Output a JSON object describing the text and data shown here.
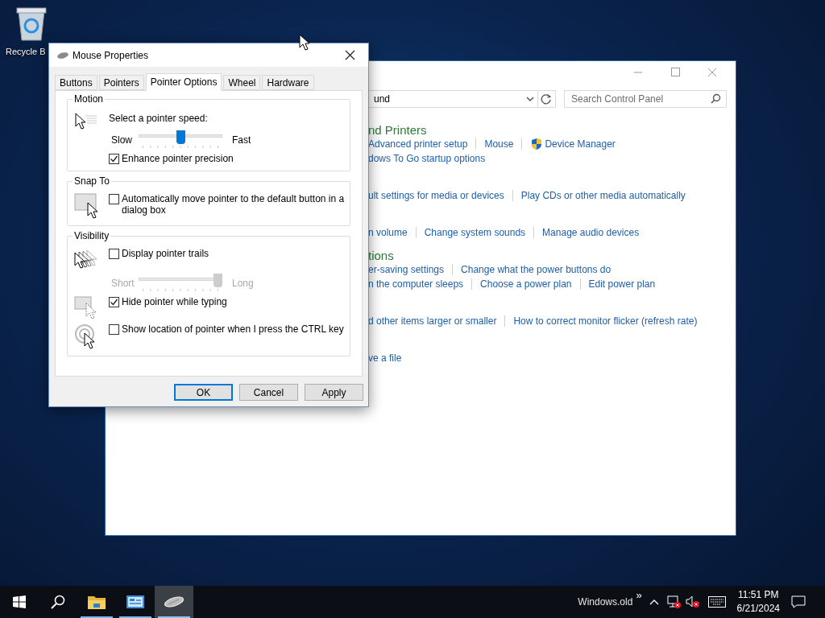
{
  "desktop": {
    "icons": [
      {
        "label": "Recycle B"
      }
    ]
  },
  "control_panel": {
    "address": "und",
    "search_placeholder": "Search Control Panel",
    "sections": [
      {
        "heading": "nd Printers",
        "rows": [
          [
            {
              "text": "Advanced printer setup"
            },
            {
              "text": "Mouse"
            },
            {
              "text": "Device Manager",
              "shield": true
            }
          ],
          [
            {
              "text": "dows To Go startup options"
            }
          ]
        ]
      },
      {
        "rows": [
          [
            {
              "text": "ult settings for media or devices"
            },
            {
              "text": "Play CDs or other media automatically"
            }
          ]
        ]
      },
      {
        "rows": [
          [
            {
              "text": "n volume"
            },
            {
              "text": "Change system sounds"
            },
            {
              "text": "Manage audio devices"
            }
          ]
        ]
      },
      {
        "heading": "tions",
        "rows": [
          [
            {
              "text": "er-saving settings"
            },
            {
              "text": "Change what the power buttons do"
            }
          ],
          [
            {
              "text": "n the computer sleeps"
            },
            {
              "text": "Choose a power plan"
            },
            {
              "text": "Edit power plan"
            }
          ]
        ]
      },
      {
        "rows": [
          [
            {
              "text": "d other items larger or smaller"
            },
            {
              "text": "How to correct monitor flicker (refresh rate)"
            }
          ]
        ]
      },
      {
        "rows": [
          [
            {
              "text": "ve a file"
            }
          ]
        ]
      }
    ]
  },
  "dialog": {
    "title": "Mouse Properties",
    "tabs": [
      {
        "label": "Buttons",
        "selected": false
      },
      {
        "label": "Pointers",
        "selected": false
      },
      {
        "label": "Pointer Options",
        "selected": true
      },
      {
        "label": "Wheel",
        "selected": false
      },
      {
        "label": "Hardware",
        "selected": false
      }
    ],
    "groups": [
      {
        "title": "Motion",
        "items": [
          {
            "kind": "slider",
            "label": "Select a pointer speed:",
            "min_label": "Slow",
            "max_label": "Fast",
            "level": 0.5,
            "disabled": false
          },
          {
            "kind": "checkbox",
            "label": "Enhance pointer precision",
            "checked": true
          }
        ]
      },
      {
        "title": "Snap To",
        "items": [
          {
            "kind": "checkbox",
            "label": "Automatically move pointer to the default button in a dialog box",
            "checked": false
          }
        ]
      },
      {
        "title": "Visibility",
        "items": [
          {
            "kind": "checkbox",
            "label": "Display pointer trails",
            "checked": false
          },
          {
            "kind": "slider",
            "min_label": "Short",
            "max_label": "Long",
            "level": 1,
            "disabled": true
          },
          {
            "kind": "checkbox",
            "label": "Hide pointer while typing",
            "checked": true
          },
          {
            "kind": "checkbox",
            "label": "Show location of pointer when I press the CTRL key",
            "checked": false
          }
        ]
      }
    ],
    "buttons": [
      {
        "label": "OK",
        "default": true
      },
      {
        "label": "Cancel",
        "default": false
      },
      {
        "label": "Apply",
        "default": false
      }
    ]
  },
  "taskbar": {
    "items": [
      {
        "kind": "start"
      },
      {
        "kind": "search"
      },
      {
        "kind": "folder",
        "open": true,
        "selected": false
      },
      {
        "kind": "control-panel",
        "open": true,
        "selected": false
      },
      {
        "kind": "mouse",
        "open": true,
        "selected": true
      }
    ],
    "toolbar_label": "Windows.old",
    "overflow": "»",
    "time": "11:51 PM",
    "date": "6/21/2024"
  }
}
